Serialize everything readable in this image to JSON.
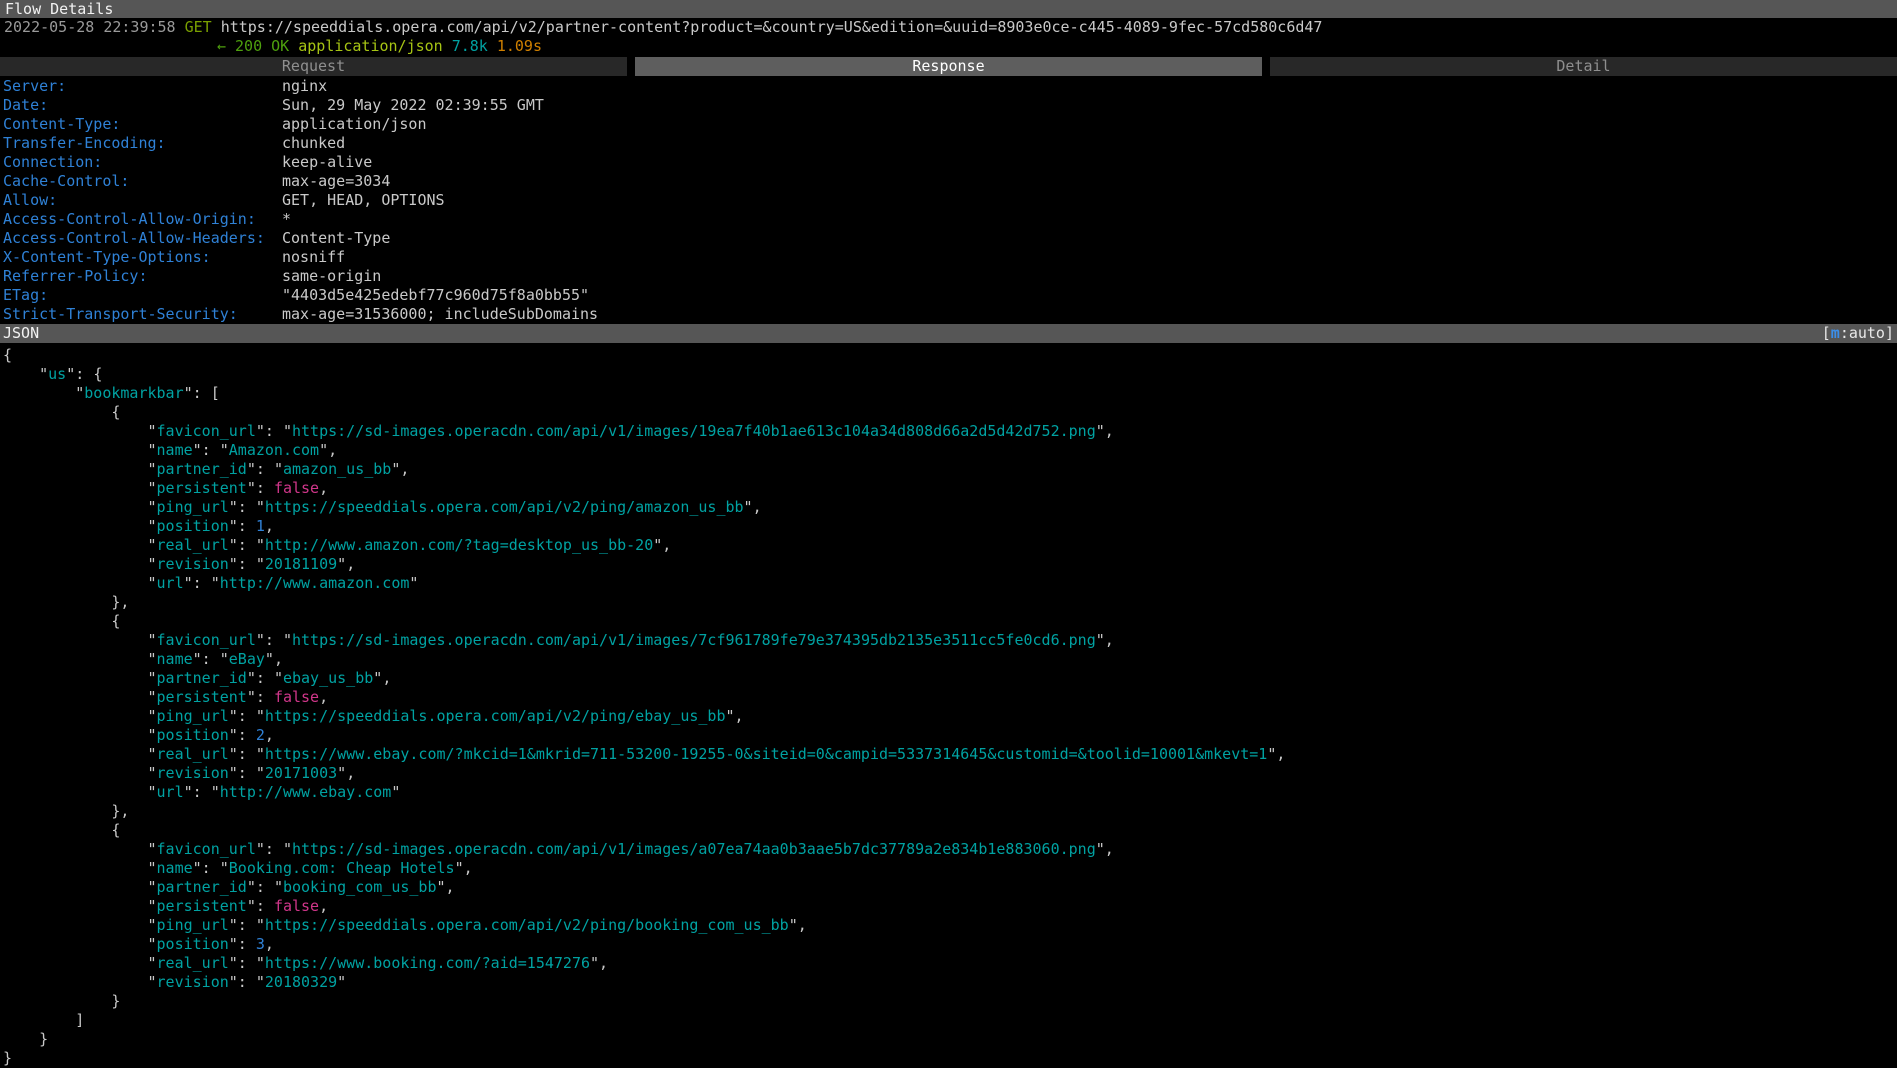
{
  "window": {
    "title": "Flow Details"
  },
  "flow": {
    "timestamp": "2022-05-28 22:39:58",
    "method": "GET",
    "url": "https://speeddials.opera.com/api/v2/partner-content?product=&country=US&edition=&uuid=8903e0ce-c445-4089-9fec-57cd580c6d47",
    "arrow": "←",
    "status": "200 OK",
    "content_type": "application/json",
    "size": "7.8k",
    "duration": "1.09s"
  },
  "tabs": [
    {
      "label": "Request",
      "active": false
    },
    {
      "label": "Response",
      "active": true
    },
    {
      "label": "Detail",
      "active": false
    }
  ],
  "response_headers": [
    {
      "name": "Server:",
      "value": "nginx"
    },
    {
      "name": "Date:",
      "value": "Sun, 29 May 2022 02:39:55 GMT"
    },
    {
      "name": "Content-Type:",
      "value": "application/json"
    },
    {
      "name": "Transfer-Encoding:",
      "value": "chunked"
    },
    {
      "name": "Connection:",
      "value": "keep-alive"
    },
    {
      "name": "Cache-Control:",
      "value": "max-age=3034"
    },
    {
      "name": "Allow:",
      "value": "GET, HEAD, OPTIONS"
    },
    {
      "name": "Access-Control-Allow-Origin:",
      "value": "*"
    },
    {
      "name": "Access-Control-Allow-Headers:",
      "value": "Content-Type"
    },
    {
      "name": "X-Content-Type-Options:",
      "value": "nosniff"
    },
    {
      "name": "Referrer-Policy:",
      "value": "same-origin"
    },
    {
      "name": "ETag:",
      "value": "\"4403d5e425edebf77c960d75f8a0bb55\""
    },
    {
      "name": "Strict-Transport-Security:",
      "value": "max-age=31536000; includeSubDomains"
    }
  ],
  "json_section": {
    "label": "JSON",
    "mode": {
      "prefix": "[",
      "key": "m",
      "suffix": ":auto]"
    }
  },
  "json_body": {
    "us": {
      "bookmarkbar": [
        {
          "favicon_url": "https://sd-images.operacdn.com/api/v1/images/19ea7f40b1ae613c104a34d808d66a2d5d42d752.png",
          "name": "Amazon.com",
          "partner_id": "amazon_us_bb",
          "persistent": false,
          "ping_url": "https://speeddials.opera.com/api/v2/ping/amazon_us_bb",
          "position": 1,
          "real_url": "http://www.amazon.com/?tag=desktop_us_bb-20",
          "revision": "20181109",
          "url": "http://www.amazon.com"
        },
        {
          "favicon_url": "https://sd-images.operacdn.com/api/v1/images/7cf961789fe79e374395db2135e3511cc5fe0cd6.png",
          "name": "eBay",
          "partner_id": "ebay_us_bb",
          "persistent": false,
          "ping_url": "https://speeddials.opera.com/api/v2/ping/ebay_us_bb",
          "position": 2,
          "real_url": "https://www.ebay.com/?mkcid=1&mkrid=711-53200-19255-0&siteid=0&campid=5337314645&customid=&toolid=10001&mkevt=1",
          "revision": "20171003",
          "url": "http://www.ebay.com"
        },
        {
          "favicon_url": "https://sd-images.operacdn.com/api/v1/images/a07ea74aa0b3aae5b7dc37789a2e834b1e883060.png",
          "name": "Booking.com: Cheap Hotels",
          "partner_id": "booking_com_us_bb",
          "persistent": false,
          "ping_url": "https://speeddials.opera.com/api/v2/ping/booking_com_us_bb",
          "position": 3,
          "real_url": "https://www.booking.com/?aid=1547276",
          "revision": "20180329"
        }
      ]
    }
  },
  "colors": {
    "background": "#000000",
    "bar_gray": "#565656",
    "key_blue": "#2f81d6",
    "json_cyan": "#00a2a2",
    "bool_magenta": "#d0368a",
    "status_green": "#4ea00e",
    "ctype_yellow_green": "#a6c414",
    "size_cyan": "#00a2a2",
    "time_orange": "#d08000"
  }
}
